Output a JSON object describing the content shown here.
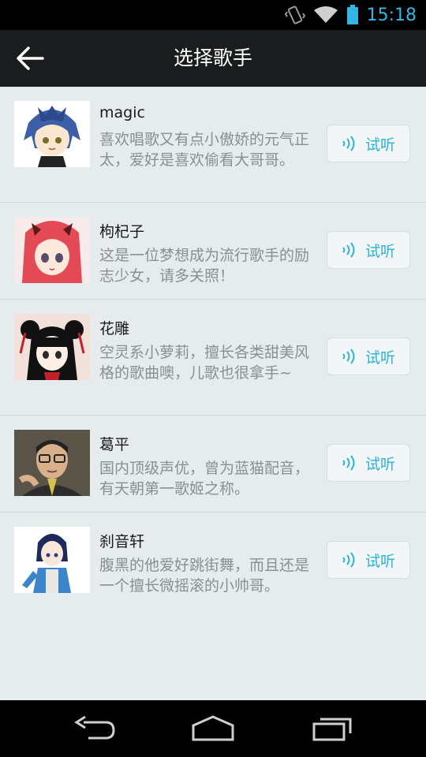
{
  "status_bar": {
    "time": "15:18"
  },
  "app_bar": {
    "title": "选择歌手"
  },
  "singers": [
    {
      "name": "magic",
      "description": "喜欢唱歌又有点小傲娇的元气正太，爱好是喜欢偷看大哥哥。",
      "listen_label": "试听"
    },
    {
      "name": "枸杞子",
      "description": "这是一位梦想成为流行歌手的励志少女，请多关照！",
      "listen_label": "试听"
    },
    {
      "name": "花雕",
      "description": "空灵系小萝莉，擅长各类甜美风格的歌曲噢，儿歌也很拿手~",
      "listen_label": "试听"
    },
    {
      "name": "葛平",
      "description": "国内顶级声优，曾为蓝猫配音，有天朝第一歌姬之称。",
      "listen_label": "试听"
    },
    {
      "name": "刹音轩",
      "description": "腹黑的他爱好跳街舞，而且还是一个擅长微摇滚的小帅哥。",
      "listen_label": "试听"
    }
  ],
  "colors": {
    "accent": "#2bb3d9",
    "status_accent": "#33b5e5",
    "background": "#e6ecee",
    "app_bar": "#1b1c1e"
  }
}
